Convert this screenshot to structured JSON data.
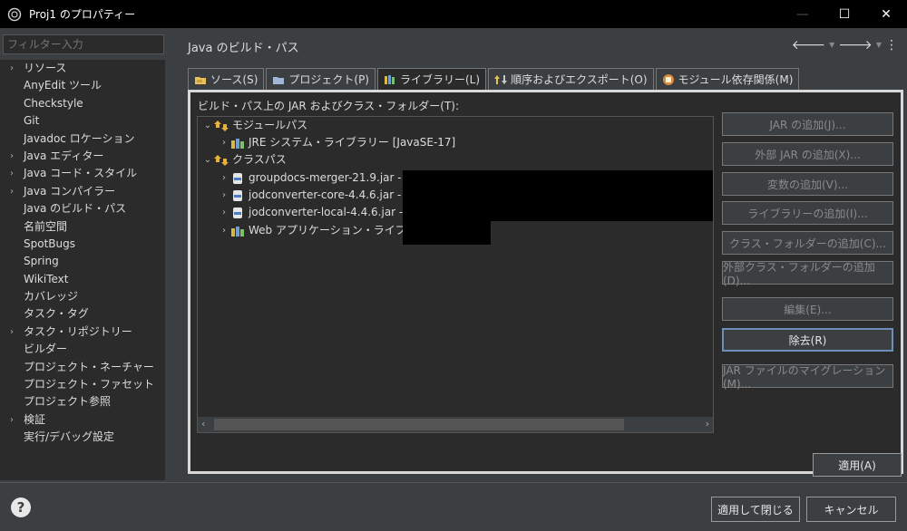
{
  "window": {
    "title": "Proj1 のプロパティー",
    "minimize_icon": "—",
    "maximize_icon": "☐",
    "close_icon": "✕"
  },
  "filter": {
    "placeholder": "フィルター入力"
  },
  "sidebar": {
    "items": [
      {
        "label": "リソース",
        "expandable": true
      },
      {
        "label": "AnyEdit ツール",
        "expandable": false
      },
      {
        "label": "Checkstyle",
        "expandable": false
      },
      {
        "label": "Git",
        "expandable": false
      },
      {
        "label": "Javadoc ロケーション",
        "expandable": false
      },
      {
        "label": "Java エディター",
        "expandable": true
      },
      {
        "label": "Java コード・スタイル",
        "expandable": true
      },
      {
        "label": "Java コンパイラー",
        "expandable": true
      },
      {
        "label": "Java のビルド・パス",
        "expandable": false
      },
      {
        "label": "名前空間",
        "expandable": false
      },
      {
        "label": "SpotBugs",
        "expandable": false
      },
      {
        "label": "Spring",
        "expandable": false
      },
      {
        "label": "WikiText",
        "expandable": false
      },
      {
        "label": "カバレッジ",
        "expandable": false
      },
      {
        "label": "タスク・タグ",
        "expandable": false
      },
      {
        "label": "タスク・リポジトリー",
        "expandable": true
      },
      {
        "label": "ビルダー",
        "expandable": false
      },
      {
        "label": "プロジェクト・ネーチャー",
        "expandable": false
      },
      {
        "label": "プロジェクト・ファセット",
        "expandable": false
      },
      {
        "label": "プロジェクト参照",
        "expandable": false
      },
      {
        "label": "検証",
        "expandable": true
      },
      {
        "label": "実行/デバッグ設定",
        "expandable": false
      }
    ]
  },
  "main": {
    "title": "Java のビルド・パス",
    "tabs": [
      {
        "label": "ソース(S)",
        "icon": "source-folder-icon"
      },
      {
        "label": "プロジェクト(P)",
        "icon": "project-folder-icon"
      },
      {
        "label": "ライブラリー(L)",
        "icon": "library-icon"
      },
      {
        "label": "順序およびエクスポート(O)",
        "icon": "order-icon"
      },
      {
        "label": "モジュール依存関係(M)",
        "icon": "module-icon"
      }
    ],
    "body_label": "ビルド・パス上の JAR およびクラス・フォルダー(T):",
    "tree": {
      "modulepath": "モジュールパス",
      "jre": "JRE システム・ライブラリー [JavaSE-17]",
      "classpath": "クラスパス",
      "jar1": "groupdocs-merger-21.9.jar -",
      "jar2": "jodconverter-core-4.4.6.jar -",
      "jar3": "jodconverter-local-4.4.6.jar -",
      "weblib": "Web アプリケーション・ライブラリー"
    },
    "buttons": {
      "add_jar": "JAR の追加(J)...",
      "add_external_jar": "外部 JAR の追加(X)...",
      "add_variable": "変数の追加(V)...",
      "add_library": "ライブラリーの追加(I)...",
      "add_class_folder": "クラス・フォルダーの追加(C)...",
      "add_external_class_folder": "外部クラス・フォルダーの追加(D)...",
      "edit": "編集(E)...",
      "remove": "除去(R)",
      "migrate_jar": "JAR ファイルのマイグレーション(M)..."
    }
  },
  "footer": {
    "apply": "適用(A)",
    "apply_close": "適用して閉じる",
    "cancel": "キャンセル",
    "help_icon": "?"
  }
}
